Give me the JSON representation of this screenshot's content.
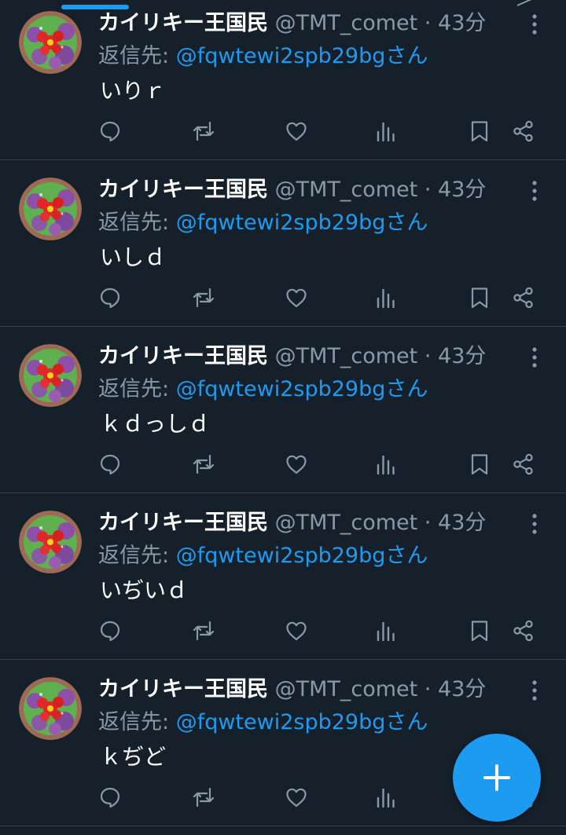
{
  "colors": {
    "background": "#15202b",
    "accent": "#1d9bf0",
    "divider": "#38444d",
    "text_primary": "#ffffff",
    "text_secondary": "#8b98a5"
  },
  "icons": {
    "more": "more-vertical-icon",
    "reply": "reply-icon",
    "retweet": "retweet-icon",
    "like": "heart-icon",
    "views": "views-icon",
    "bookmark": "bookmark-icon",
    "share": "share-icon",
    "compose": "plus-icon"
  },
  "tweets": [
    {
      "display_name": "カイリキー王国民",
      "handle": "@TMT_comet",
      "separator": "·",
      "time": "43分",
      "reply_prefix": "返信先:",
      "reply_to": "@fqwtewi2spb29bgさん",
      "text": "いりｒ"
    },
    {
      "display_name": "カイリキー王国民",
      "handle": "@TMT_comet",
      "separator": "·",
      "time": "43分",
      "reply_prefix": "返信先:",
      "reply_to": "@fqwtewi2spb29bgさん",
      "text": "いしｄ"
    },
    {
      "display_name": "カイリキー王国民",
      "handle": "@TMT_comet",
      "separator": "·",
      "time": "43分",
      "reply_prefix": "返信先:",
      "reply_to": "@fqwtewi2spb29bgさん",
      "text": "ｋｄっしｄ"
    },
    {
      "display_name": "カイリキー王国民",
      "handle": "@TMT_comet",
      "separator": "·",
      "time": "43分",
      "reply_prefix": "返信先:",
      "reply_to": "@fqwtewi2spb29bgさん",
      "text": "いぢいｄ"
    },
    {
      "display_name": "カイリキー王国民",
      "handle": "@TMT_comet",
      "separator": "·",
      "time": "43分",
      "reply_prefix": "返信先:",
      "reply_to": "@fqwtewi2spb29bgさん",
      "text": "ｋぢど"
    }
  ]
}
